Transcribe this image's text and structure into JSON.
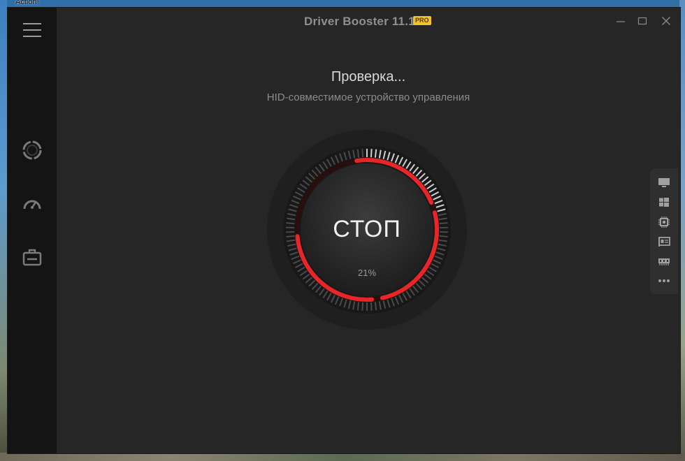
{
  "desktop": {
    "label": "Action!"
  },
  "window": {
    "title": "Driver Booster 11.1",
    "badge": "PRO",
    "controls": [
      "minimize",
      "maximize",
      "close"
    ]
  },
  "sidebar": {
    "items": [
      {
        "name": "menu",
        "icon": "hamburger-icon"
      },
      {
        "name": "scan",
        "icon": "scan-ring-icon"
      },
      {
        "name": "boost",
        "icon": "speedometer-icon"
      },
      {
        "name": "toolbox",
        "icon": "toolbox-icon"
      }
    ]
  },
  "scan": {
    "status": "Проверка...",
    "current_item": "HID-совместимое устройство управления",
    "button_label": "СТОП",
    "progress_text": "21%",
    "progress": 0.21
  },
  "categories": {
    "icons": [
      "monitor-icon",
      "windows-icon",
      "chip-icon",
      "network-card-icon",
      "memory-icon",
      "more-icon"
    ]
  },
  "colors": {
    "accent": "#e8262a",
    "background": "#262626",
    "sidebar": "#141414",
    "badge": "#f3c12a"
  }
}
